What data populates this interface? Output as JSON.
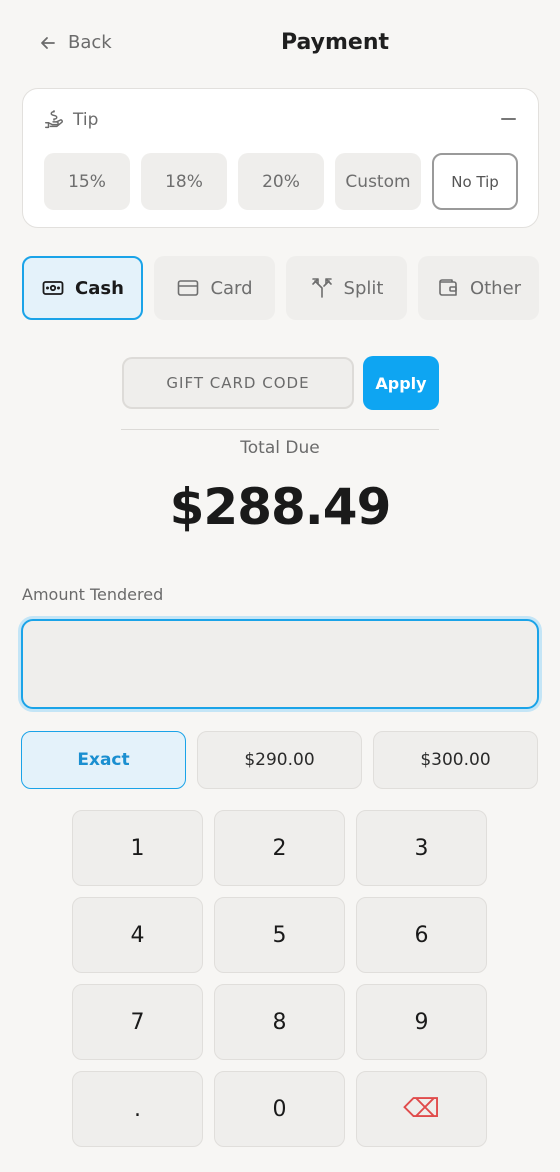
{
  "header": {
    "back_label": "Back",
    "title": "Payment"
  },
  "tip": {
    "label": "Tip",
    "options": [
      "15%",
      "18%",
      "20%",
      "Custom",
      "No Tip"
    ],
    "selected": "No Tip"
  },
  "methods": [
    {
      "label": "Cash",
      "icon": "cash-icon",
      "active": true
    },
    {
      "label": "Card",
      "icon": "card-icon",
      "active": false
    },
    {
      "label": "Split",
      "icon": "split-icon",
      "active": false
    },
    {
      "label": "Other",
      "icon": "wallet-icon",
      "active": false
    }
  ],
  "gift_card": {
    "placeholder": "GIFT CARD CODE",
    "apply_label": "Apply"
  },
  "total": {
    "label": "Total Due",
    "amount": "$288.49"
  },
  "tendered": {
    "label": "Amount Tendered",
    "value": ""
  },
  "quick_amounts": [
    "Exact",
    "$290.00",
    "$300.00"
  ],
  "keypad": [
    "1",
    "2",
    "3",
    "4",
    "5",
    "6",
    "7",
    "8",
    "9",
    ".",
    "0",
    "⌫"
  ],
  "colors": {
    "accent": "#0ea5f2",
    "accent_light": "#e4f2fa",
    "delete": "#e04b4b"
  }
}
